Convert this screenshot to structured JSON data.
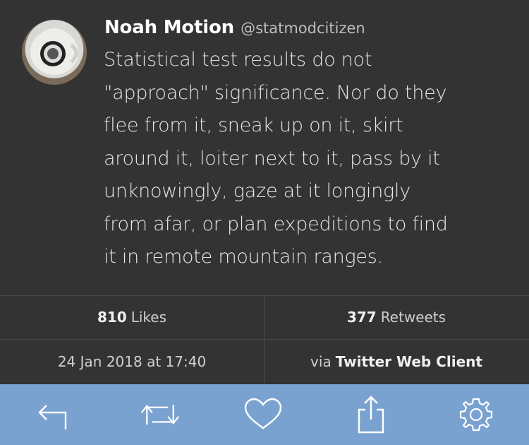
{
  "tweet": {
    "display_name": "Noah Motion",
    "handle": "@statmodcitizen",
    "text_lines": [
      "Statistical test results do not",
      "\"approach\" significance. Nor do they",
      "flee from it, sneak up on it, skirt",
      "around it, loiter next to it, pass by it",
      "unknowingly, gaze at it longingly",
      "from afar, or plan expeditions to find",
      "it in remote mountain ranges."
    ]
  },
  "stats": {
    "likes_count": "810",
    "likes_label": "Likes",
    "retweets_count": "377",
    "retweets_label": "Retweets",
    "timestamp": "24 Jan 2018 at 17:40",
    "via_prefix": "via",
    "client": "Twitter Web Client"
  },
  "toolbar": {
    "color": "#7aa2d1",
    "icons": [
      "reply-icon",
      "retweet-icon",
      "like-icon",
      "share-icon",
      "settings-icon"
    ]
  }
}
